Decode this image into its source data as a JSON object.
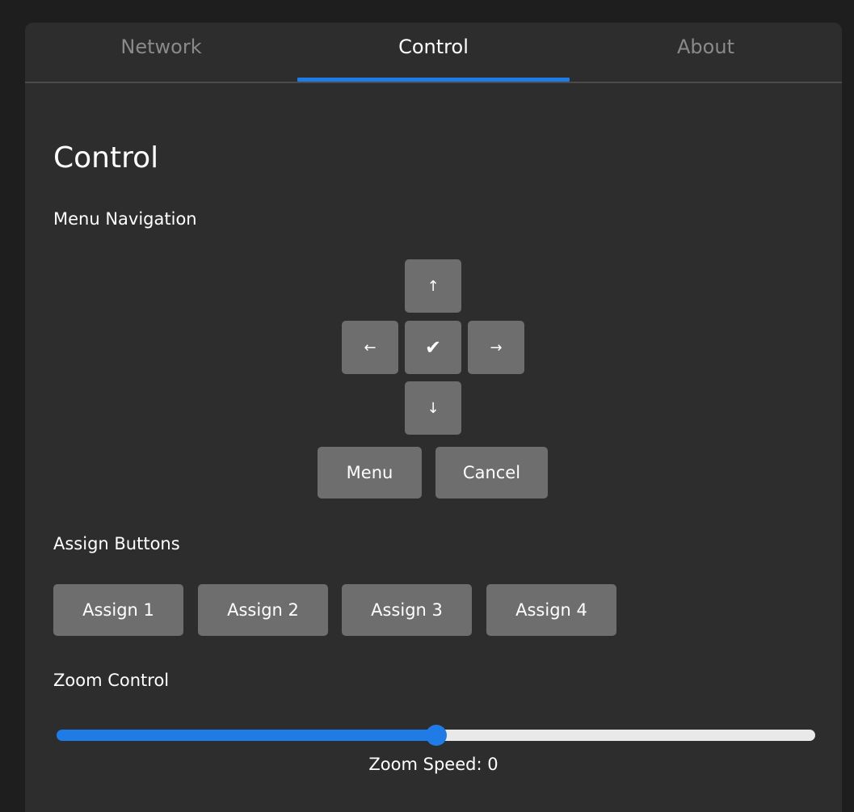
{
  "tabs": [
    {
      "label": "Network",
      "active": false
    },
    {
      "label": "Control",
      "active": true
    },
    {
      "label": "About",
      "active": false
    }
  ],
  "page": {
    "title": "Control"
  },
  "menu_navigation": {
    "label": "Menu Navigation",
    "up": "↑",
    "left": "←",
    "ok": "✔",
    "right": "→",
    "down": "↓",
    "menu": "Menu",
    "cancel": "Cancel"
  },
  "assign_buttons": {
    "label": "Assign Buttons",
    "items": [
      "Assign 1",
      "Assign 2",
      "Assign 3",
      "Assign 4"
    ]
  },
  "zoom_control": {
    "label": "Zoom Control",
    "slider_fraction": 0.5,
    "readout": "Zoom Speed: 0"
  },
  "colors": {
    "accent": "#1f7ce6",
    "panel": "#2d2d2d",
    "button": "#6e6e6e",
    "inactive_tab": "#8a8a8a"
  },
  "icons": {
    "up": "arrow-up-icon",
    "down": "arrow-down-icon",
    "left": "arrow-left-icon",
    "right": "arrow-right-icon",
    "ok": "checkmark-icon"
  }
}
